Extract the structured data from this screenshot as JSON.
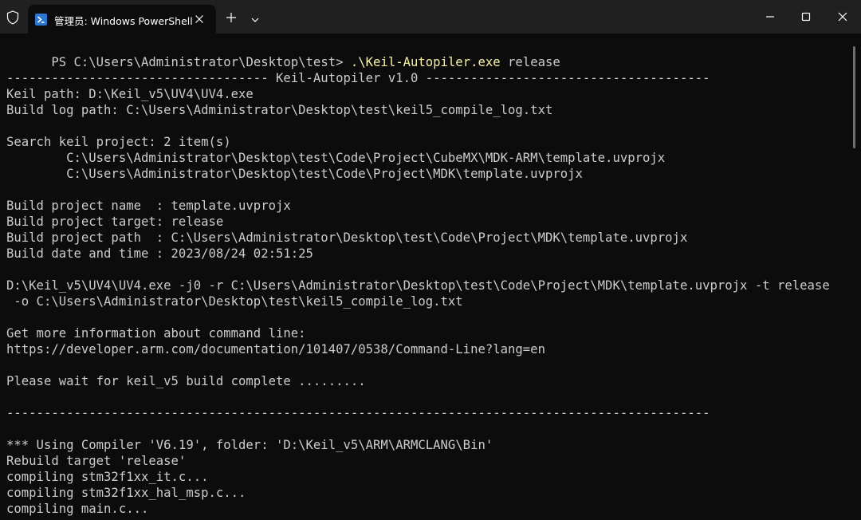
{
  "window": {
    "tab_title": "管理员: Windows PowerShell",
    "buttons": [
      "minimize",
      "maximize",
      "close"
    ]
  },
  "icons": {
    "security": "shield-icon",
    "app": "powershell-icon",
    "tab_close": "close-icon",
    "new_tab": "plus-icon",
    "dropdown": "chevron-down-icon"
  },
  "colors": {
    "background": "#0c0c0c",
    "titlebar": "#202020",
    "text": "#cccccc",
    "command_highlight": "#f9f1a5",
    "powershell_icon": "#2a78d4"
  },
  "terminal": {
    "prompt": {
      "path": "PS C:\\Users\\Administrator\\Desktop\\test> ",
      "command": ".\\Keil-Autopiler.exe",
      "args": " release"
    },
    "lines": [
      "",
      "----------------------------------- Keil-Autopiler v1.0 --------------------------------------",
      "Keil path: D:\\Keil_v5\\UV4\\UV4.exe",
      "Build log path: C:\\Users\\Administrator\\Desktop\\test\\keil5_compile_log.txt",
      "",
      "Search keil project: 2 item(s)",
      "        C:\\Users\\Administrator\\Desktop\\test\\Code\\Project\\CubeMX\\MDK-ARM\\template.uvprojx",
      "        C:\\Users\\Administrator\\Desktop\\test\\Code\\Project\\MDK\\template.uvprojx",
      "",
      "Build project name  : template.uvprojx",
      "Build project target: release",
      "Build project path  : C:\\Users\\Administrator\\Desktop\\test\\Code\\Project\\MDK\\template.uvprojx",
      "Build date and time : 2023/08/24 02:51:25",
      "",
      "D:\\Keil_v5\\UV4\\UV4.exe -j0 -r C:\\Users\\Administrator\\Desktop\\test\\Code\\Project\\MDK\\template.uvprojx -t release",
      " -o C:\\Users\\Administrator\\Desktop\\test\\keil5_compile_log.txt",
      "",
      "Get more information about command line:",
      "https://developer.arm.com/documentation/101407/0538/Command-Line?lang=en",
      "",
      "Please wait for keil_v5 build complete .........",
      "",
      "----------------------------------------------------------------------------------------------",
      "",
      "*** Using Compiler 'V6.19', folder: 'D:\\Keil_v5\\ARM\\ARMCLANG\\Bin'",
      "Rebuild target 'release'",
      "compiling stm32f1xx_it.c...",
      "compiling stm32f1xx_hal_msp.c...",
      "compiling main.c..."
    ]
  }
}
